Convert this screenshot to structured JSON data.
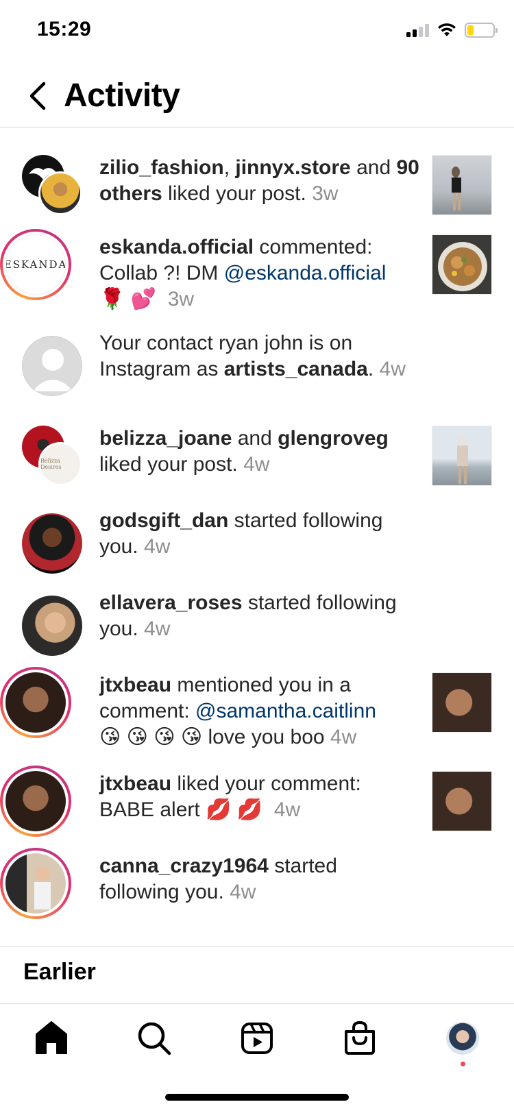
{
  "status_bar": {
    "time": "15:29"
  },
  "header": {
    "title": "Activity"
  },
  "activity": [
    {
      "users": [
        "zilio_fashion",
        "jinnyx.store"
      ],
      "conj": " and ",
      "others": "90 others",
      "action": " liked your post. ",
      "time": "3w"
    },
    {
      "user": "eskanda.official",
      "action": " commented: Collab ?! DM ",
      "mention": "@eskanda.official",
      "emoji": "🌹 💕",
      "time": "3w",
      "avatar_text": "ESKANDA"
    },
    {
      "prefix": "Your contact ryan john is on Instagram as ",
      "user": "artists_canada",
      "suffix": ". ",
      "time": "4w"
    },
    {
      "users": [
        "belizza_joane",
        "glengroveg"
      ],
      "conj": " and ",
      "action": " liked your post. ",
      "time": "4w",
      "avatar_text": "Belizza Desires"
    },
    {
      "user": "godsgift_dan",
      "action": " started following you. ",
      "time": "4w"
    },
    {
      "user": "ellavera_roses",
      "action": " started following you. ",
      "time": "4w"
    },
    {
      "user": "jtxbeau",
      "action": " mentioned you in a comment: ",
      "mention": "@samantha.caitlinn",
      "emoji": "😘 😘 😘 😘",
      "text_after": " love you boo ",
      "time": "4w"
    },
    {
      "user": "jtxbeau",
      "action": " liked your comment: BABE alert ",
      "emoji": "💋 💋",
      "time": "4w"
    },
    {
      "user": "canna_crazy1964",
      "action": " started following you. ",
      "time": "4w"
    }
  ],
  "section": {
    "earlier": "Earlier"
  },
  "colors": {
    "mention": "#00376b",
    "time": "#8e8e8e",
    "story_ring": "#e1306c",
    "notification_dot": "#ed4956"
  },
  "icons": {
    "back": "chevron-left-icon",
    "home": "home-icon",
    "search": "search-icon",
    "reels": "reels-icon",
    "shop": "shop-icon"
  }
}
